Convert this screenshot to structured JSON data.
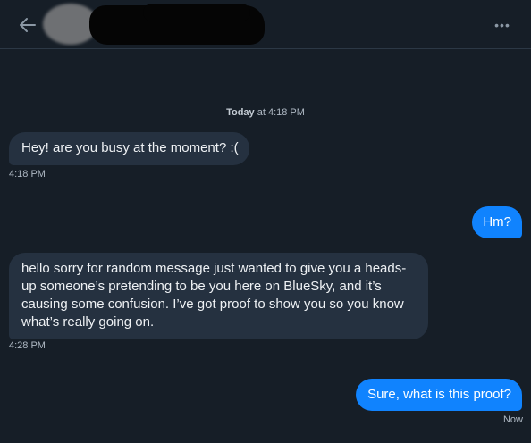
{
  "header": {
    "back_icon": "arrow-left-icon",
    "more_icon": "more-horizontal-icon",
    "more_glyph": "•••"
  },
  "conversation": {
    "day_label": "Today",
    "day_time": "at 4:18 PM",
    "messages": [
      {
        "direction": "incoming",
        "text": "Hey! are you busy at the moment? :(",
        "time": "4:18 PM"
      },
      {
        "direction": "outgoing",
        "text": "Hm?",
        "time": ""
      },
      {
        "direction": "incoming",
        "text": "hello sorry for random message just wanted to give you a heads-up someone’s pretending to be you here on BlueSky, and it’s causing some confusion. I’ve got proof to show you so you know what’s really going on.",
        "time": "4:28 PM"
      },
      {
        "direction": "outgoing",
        "text": "Sure, what is this proof?",
        "time": "Now"
      }
    ]
  },
  "colors": {
    "background": "#161e27",
    "incoming_bubble": "#253140",
    "outgoing_bubble": "#1083fe",
    "muted_text": "#aeb8c3"
  }
}
